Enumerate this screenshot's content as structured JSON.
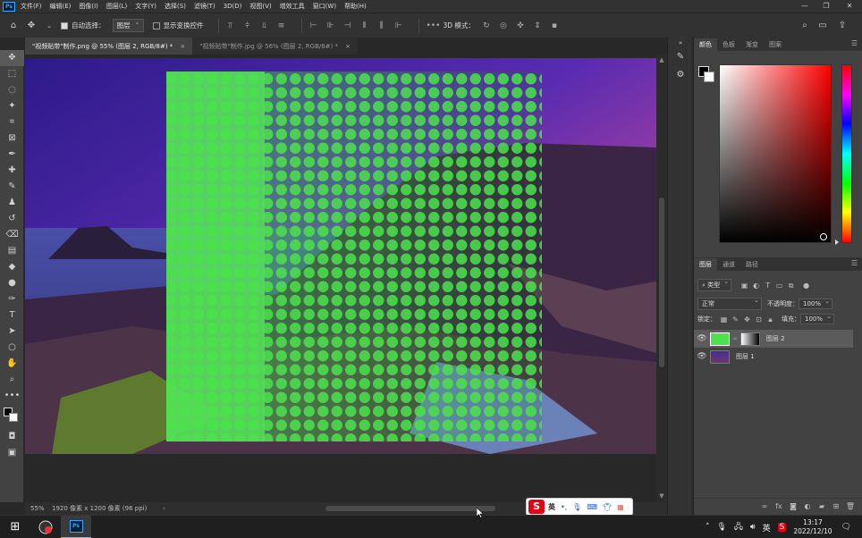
{
  "app": {
    "logo": "Ps",
    "menu": [
      "文件(F)",
      "编辑(E)",
      "图像(I)",
      "图层(L)",
      "文字(Y)",
      "选择(S)",
      "滤镜(T)",
      "3D(D)",
      "视图(V)",
      "增效工具",
      "窗口(W)",
      "帮助(H)"
    ]
  },
  "options": {
    "auto_select_label": "自动选择：",
    "auto_select_value": "图层",
    "show_transform_label": "显示变换控件",
    "three_d_mode_label": "3D 模式："
  },
  "tabs": [
    {
      "label": "\"视频贴带\"制作.png @ 55% (图层 2, RGB/8#) *",
      "close": "×"
    },
    {
      "label": "\"视频贴带\"制作.jpg @ 56% (图层 2, RGB/8#) *",
      "close": "×"
    }
  ],
  "status": {
    "zoom": "55%",
    "doc_info": "1920 像素 x 1200 像素 (96 ppi)"
  },
  "color_panel": {
    "tabs": [
      "颜色",
      "色板",
      "渐变",
      "图案"
    ],
    "foreground": "#000000",
    "background": "#ffffff",
    "hue_selected": "#ff0000"
  },
  "layers_panel": {
    "tabs": [
      "图层",
      "通道",
      "路径"
    ],
    "filter_label": "类型",
    "blend_mode": "正常",
    "opacity_label": "不透明度：",
    "opacity_value": "100%",
    "lock_label": "锁定：",
    "fill_label": "填充：",
    "fill_value": "100%",
    "layers": [
      {
        "name": "图层 2",
        "selected": true
      },
      {
        "name": "图层 1",
        "selected": false
      }
    ]
  },
  "ime": {
    "logo": "S",
    "lang": "英"
  },
  "taskbar": {
    "tray_lang": "英",
    "time": "13:17",
    "date": "2022/12/10"
  },
  "colors": {
    "accent_green": "#56e05a",
    "ps_blue": "#31a8ff"
  }
}
